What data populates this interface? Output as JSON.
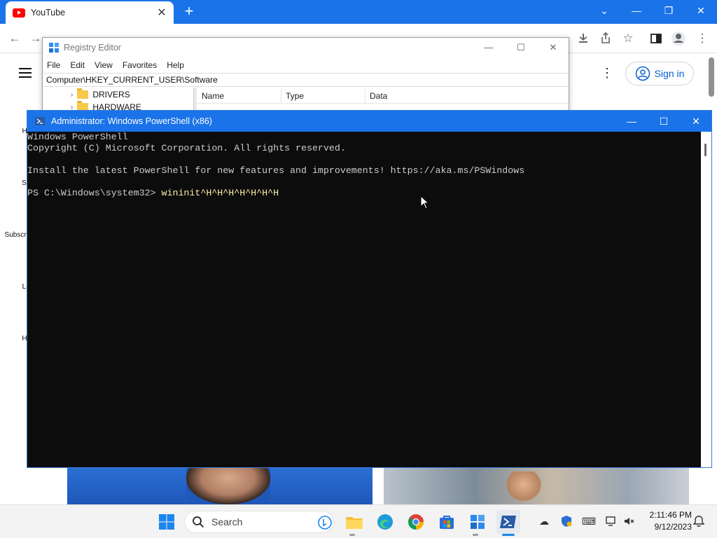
{
  "browser": {
    "tab_title": "YouTube",
    "tab_close": "✕",
    "new_tab": "+",
    "window_controls": {
      "dropdown": "⌄",
      "minimize": "—",
      "restore": "❐",
      "close": "✕"
    }
  },
  "youtube": {
    "sign_in": "Sign in",
    "sidebar": [
      "Hom",
      "Sho",
      "Subscrib",
      "Libr",
      "Hist"
    ]
  },
  "regedit": {
    "title": "Registry Editor",
    "menu": [
      "File",
      "Edit",
      "View",
      "Favorites",
      "Help"
    ],
    "address": "Computer\\HKEY_CURRENT_USER\\Software",
    "tree": [
      "DRIVERS",
      "HARDWARE"
    ],
    "columns": [
      "Name",
      "Type",
      "Data"
    ]
  },
  "powershell": {
    "title": "Administrator: Windows PowerShell (x86)",
    "lines": [
      "Windows PowerShell",
      "Copyright (C) Microsoft Corporation. All rights reserved.",
      "",
      "Install the latest PowerShell for new features and improvements! https://aka.ms/PSWindows",
      ""
    ],
    "prompt": "PS C:\\Windows\\system32> ",
    "command": "wininit^H^H^H^H^H^H^H"
  },
  "taskbar": {
    "search_placeholder": "Search",
    "time": "2:11:46 PM",
    "date": "9/12/2023"
  },
  "colors": {
    "chrome_blue": "#1a73e8",
    "console_bg": "#0c0c0c",
    "console_text": "#cccccc",
    "command_text": "#f9f1a5",
    "youtube_red": "#ff0000"
  }
}
